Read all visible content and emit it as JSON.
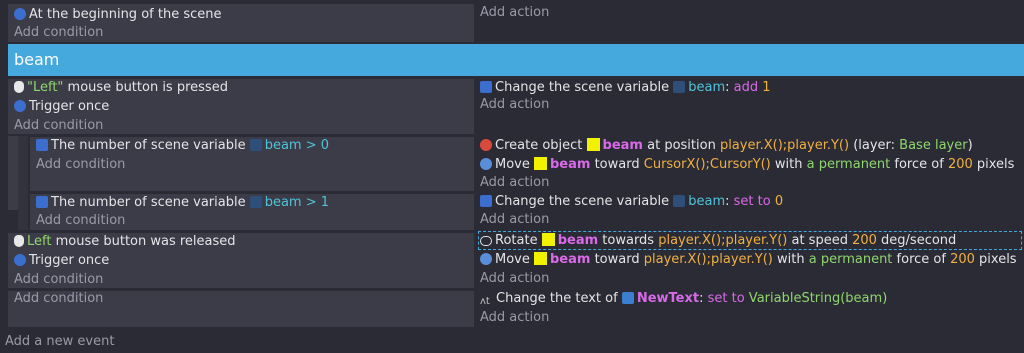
{
  "events": {
    "ev1": {
      "cond": "At the beginning of the scene",
      "add_condition": "Add condition",
      "add_action": "Add action"
    },
    "group": {
      "title": "beam",
      "color": "#45a9de"
    },
    "ev2": {
      "cond1_q": "\"Left\"",
      "cond1_rest": " mouse button is pressed",
      "cond2": "Trigger once",
      "add_condition": "Add condition",
      "act1_pre": "Change the scene variable ",
      "act1_var": "beam",
      "act1_mid": ": ",
      "act1_op": "add",
      "act1_val": " 1",
      "add_action": "Add action"
    },
    "sub1": {
      "cond_pre": "The number of scene variable ",
      "cond_var": "beam",
      "cond_cmp": " > 0",
      "add_condition": "Add condition",
      "act1_pre": "Create object ",
      "act1_obj": "beam",
      "act1_mid": " at position ",
      "act1_pos": "player.X();player.Y()",
      "act1_layer_pre": " (layer: ",
      "act1_layer": "Base layer",
      "act1_layer_post": ")",
      "act2_pre": "Move ",
      "act2_obj": "beam",
      "act2_mid": " toward ",
      "act2_pos": "CursorX();CursorY()",
      "act2_with": " with ",
      "act2_perm": "a permanent",
      "act2_force": " force of ",
      "act2_num": "200",
      "act2_unit": " pixels",
      "add_action": "Add action"
    },
    "sub2": {
      "cond_pre": "The number of scene variable ",
      "cond_var": "beam",
      "cond_cmp": " > 1",
      "add_condition": "Add condition",
      "act1_pre": "Change the scene variable ",
      "act1_var": "beam",
      "act1_mid": ": ",
      "act1_op": "set to",
      "act1_val": " 0",
      "add_action": "Add action"
    },
    "ev3": {
      "cond1_q": "Left",
      "cond1_rest": " mouse button was released",
      "cond2": "Trigger once",
      "add_condition": "Add condition",
      "act1_pre": "Rotate ",
      "act1_obj": "beam",
      "act1_mid": " towards ",
      "act1_pos": "player.X();player.Y()",
      "act1_speed": " at speed ",
      "act1_num": "200",
      "act1_unit": " deg/second",
      "act2_pre": "Move ",
      "act2_obj": "beam",
      "act2_mid": " toward ",
      "act2_pos": "player.X();player.Y()",
      "act2_with": " with ",
      "act2_perm": "a permanent",
      "act2_force": " force of ",
      "act2_num": "200",
      "act2_unit": " pixels",
      "add_action": "Add action"
    },
    "ev4": {
      "add_condition": "Add condition",
      "act1_pre": "Change the text of ",
      "act1_obj": "NewText",
      "act1_mid": ": ",
      "act1_op": "set to",
      "act1_val": " VariableString(beam)",
      "add_action": "Add action"
    }
  },
  "footer": {
    "add_event": "Add a new event"
  },
  "icons": {
    "scene_start": "scene-start-icon",
    "mouse": "mouse-icon",
    "trigger_once": "trigger-once-icon",
    "variable": "variable-icon",
    "create": "create-object-icon",
    "move": "move-icon",
    "rotate": "rotate-icon",
    "text": "text-icon"
  }
}
